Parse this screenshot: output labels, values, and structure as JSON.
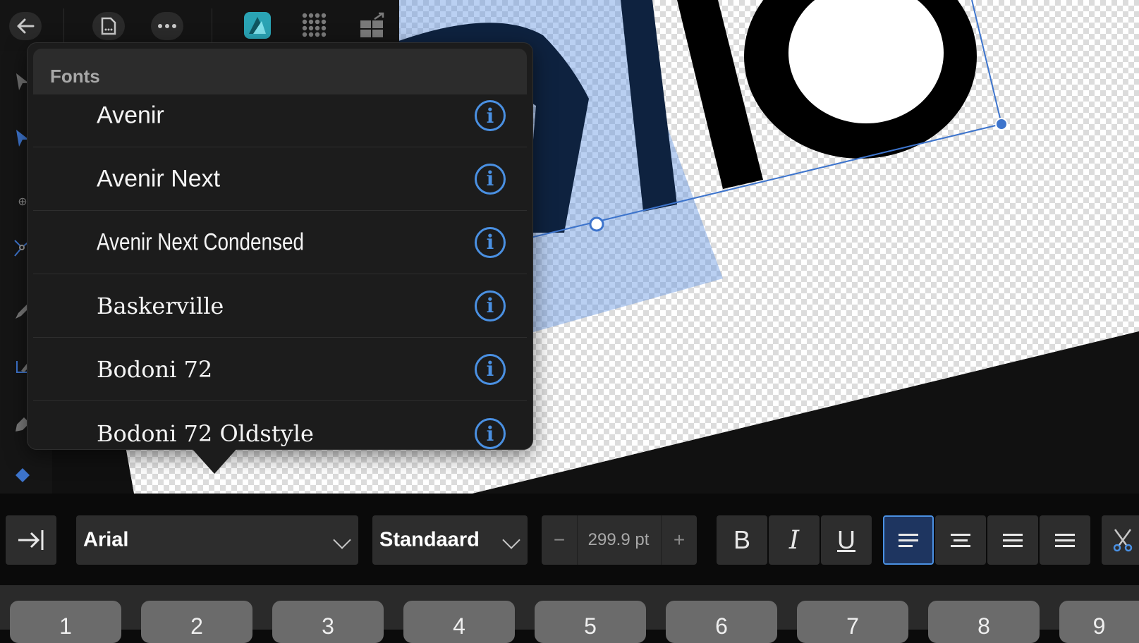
{
  "top_toolbar": {
    "icons": [
      "back-arrow-icon",
      "document-icon",
      "more-icon",
      "designer-persona-icon",
      "pixel-persona-icon",
      "export-persona-icon"
    ]
  },
  "left_tools": {
    "icons": [
      "move-tool-icon",
      "node-tool-icon",
      "point-transform-icon",
      "corner-tool-icon",
      "pencil-tool-icon",
      "vector-crop-icon",
      "pen-tool-icon",
      "fill-tool-icon"
    ]
  },
  "fonts_popover": {
    "title": "Fonts",
    "fonts": [
      {
        "name": "Avenir"
      },
      {
        "name": "Avenir Next"
      },
      {
        "name": "Avenir Next Condensed"
      },
      {
        "name": "Baskerville"
      },
      {
        "name": "Bodoni 72"
      },
      {
        "name": "Bodoni 72 Oldstyle"
      }
    ],
    "info_icon": "info-icon",
    "accent_color": "#4a90e2"
  },
  "text_toolbar": {
    "font_family": "Arial",
    "font_style": "Standaard",
    "font_size": "299.9 pt",
    "decrement": "−",
    "increment": "+",
    "bold": "B",
    "italic": "I",
    "underline": "U",
    "selected_alignment": "align-left",
    "selected_color": "#4a90e2"
  },
  "keyboard": {
    "keys": [
      "1",
      "2",
      "3",
      "4",
      "5",
      "6",
      "7",
      "8",
      "9"
    ]
  }
}
